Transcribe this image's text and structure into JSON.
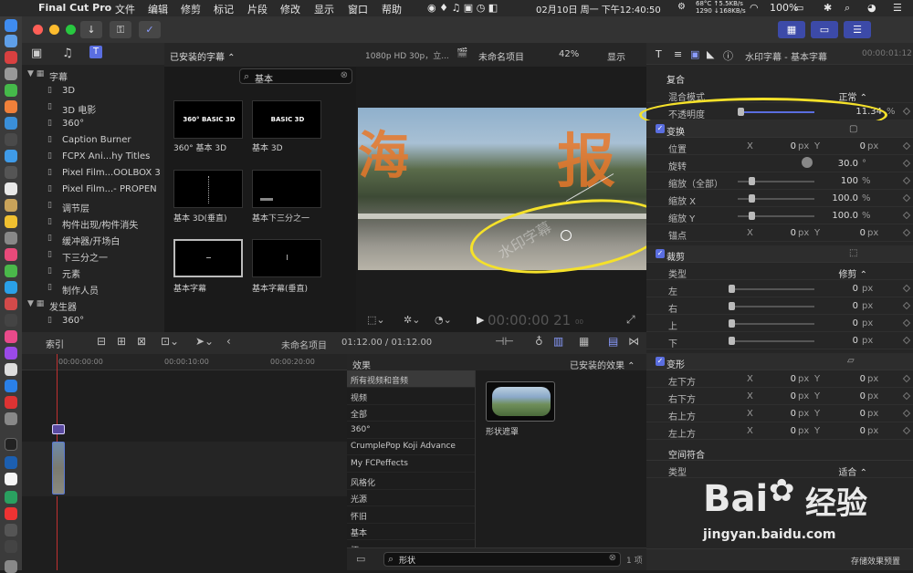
{
  "menubar": {
    "app": "Final Cut Pro",
    "menus": [
      "文件",
      "编辑",
      "修剪",
      "标记",
      "片段",
      "修改",
      "显示",
      "窗口",
      "帮助"
    ],
    "temp": "68°C",
    "net_up": "5.5KB/s",
    "net_extra": "1290",
    "net_down": "168KB/s",
    "battery": "100%",
    "datetime": "02月10日 周一 下午12:40:50"
  },
  "library": {
    "items": [
      {
        "label": "字幕",
        "level": 0
      },
      {
        "label": "3D",
        "level": 1
      },
      {
        "label": "3D 电影",
        "level": 1
      },
      {
        "label": "360°",
        "level": 1
      },
      {
        "label": "Caption Burner",
        "level": 1
      },
      {
        "label": "FCPX Ani...hy Titles",
        "level": 1
      },
      {
        "label": "Pixel Film...OOLBOX 3",
        "level": 1
      },
      {
        "label": "Pixel Film...- PROPEN",
        "level": 1
      },
      {
        "label": "调节层",
        "level": 1
      },
      {
        "label": "构件出现/构件消失",
        "level": 1
      },
      {
        "label": "缓冲器/开场白",
        "level": 1
      },
      {
        "label": "下三分之一",
        "level": 1
      },
      {
        "label": "元素",
        "level": 1
      },
      {
        "label": "制作人员",
        "level": 1
      },
      {
        "label": "发生器",
        "level": 0
      },
      {
        "label": "360°",
        "level": 1
      }
    ]
  },
  "titles": {
    "header": "已安装的字幕 ⌃",
    "search_value": "基本",
    "items": [
      {
        "caption": "360° 基本 3D",
        "thumb": "360° BASIC 3D"
      },
      {
        "caption": "基本 3D",
        "thumb": "BASIC 3D"
      },
      {
        "caption": "基本 3D(垂直)",
        "thumb": ""
      },
      {
        "caption": "基本下三分之一",
        "thumb": ""
      },
      {
        "caption": "基本字幕",
        "thumb": ""
      },
      {
        "caption": "基本字幕(垂直)",
        "thumb": ""
      }
    ]
  },
  "viewer": {
    "format": "1080p HD 30p，立...",
    "project": "未命名项目",
    "zoom": "42%",
    "display": "显示",
    "timecode": "00:00:00 21",
    "timecode_frames": "00",
    "overlay_chars": [
      "海",
      "报"
    ],
    "watermark": "水印字幕"
  },
  "inspector": {
    "title": "水印字幕 - 基本字幕",
    "timecode": "00:00:01:12",
    "sections": {
      "composite": "复合",
      "transform": "变换",
      "crop": "裁剪",
      "distort": "变形",
      "spatial": "空间符合"
    },
    "blend_label": "混合模式",
    "blend_value": "正常 ⌃",
    "opacity_label": "不透明度",
    "opacity_value": "11.34",
    "opacity_unit": "%",
    "transform_rows": [
      {
        "label": "位置",
        "x": "0",
        "y": "0",
        "unit": "px"
      },
      {
        "label": "旋转",
        "value": "30.0",
        "unit": "°"
      },
      {
        "label": "缩放（全部）",
        "value": "100",
        "unit": "%"
      },
      {
        "label": "缩放 X",
        "value": "100.0",
        "unit": "%"
      },
      {
        "label": "缩放 Y",
        "value": "100.0",
        "unit": "%"
      },
      {
        "label": "锚点",
        "x": "0",
        "y": "0",
        "unit": "px"
      }
    ],
    "crop_type_label": "类型",
    "crop_type_value": "修剪 ⌃",
    "crop_rows": [
      {
        "label": "左",
        "value": "0",
        "unit": "px"
      },
      {
        "label": "右",
        "value": "0",
        "unit": "px"
      },
      {
        "label": "上",
        "value": "0",
        "unit": "px"
      },
      {
        "label": "下",
        "value": "0",
        "unit": "px"
      }
    ],
    "distort_rows": [
      {
        "label": "左下方",
        "x": "0",
        "y": "0",
        "unit": "px"
      },
      {
        "label": "右下方",
        "x": "0",
        "y": "0",
        "unit": "px"
      },
      {
        "label": "右上方",
        "x": "0",
        "y": "0",
        "unit": "px"
      },
      {
        "label": "左上方",
        "x": "0",
        "y": "0",
        "unit": "px"
      }
    ],
    "spatial_type_label": "类型",
    "spatial_type_value": "适合 ⌃",
    "save_preset": "存储效果预置",
    "axis_x": "X",
    "axis_y": "Y"
  },
  "timeline": {
    "index": "索引",
    "project": "未命名项目",
    "duration": "01:12.00 / 01:12.00",
    "ruler": [
      "00:00:00:00",
      "00:00:10:00",
      "00:00:20:00"
    ]
  },
  "effects": {
    "header": "效果",
    "installed": "已安装的效果 ⌃",
    "categories": [
      "所有视频和音频",
      "视频",
      "全部",
      "360°",
      "CrumplePop Koji Advance",
      "My FCPeffects",
      "风格化",
      "光源",
      "怀旧",
      "基本",
      "拓..."
    ],
    "result_label": "形状遮罩",
    "search_value": "形状",
    "count": "1 项"
  },
  "watermark": {
    "brand": "Bai",
    "brand2": "经验",
    "url": "jingyan.baidu.com"
  }
}
